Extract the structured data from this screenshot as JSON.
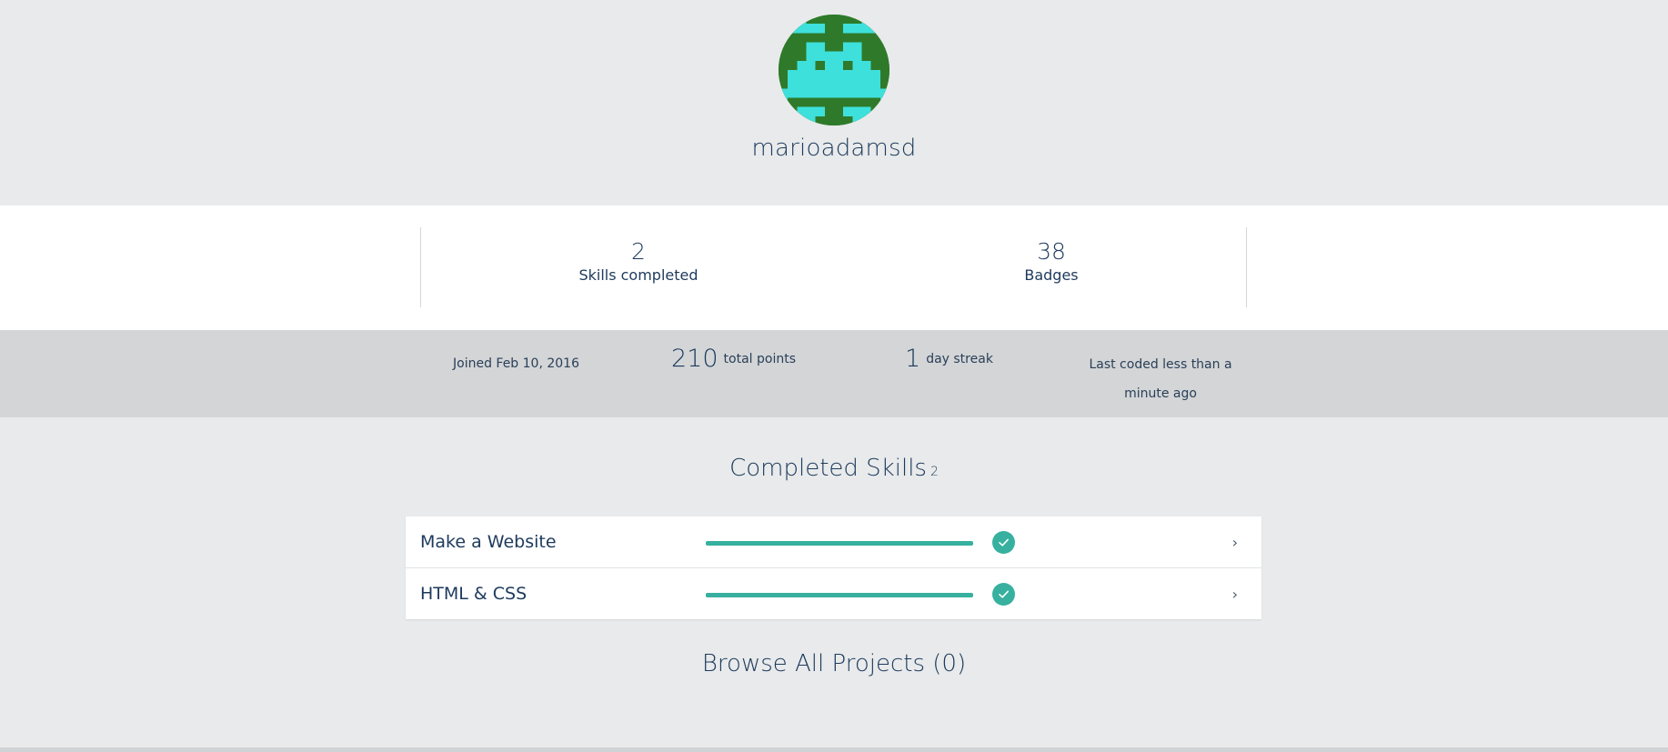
{
  "profile": {
    "username": "marioadamsd",
    "avatar_icon": "pixel-invader-avatar",
    "avatar_colors": {
      "background": "#2e7a2a",
      "foreground": "#3ee0dc"
    }
  },
  "stats": {
    "skills_completed": {
      "value": "2",
      "label": "Skills completed"
    },
    "badges": {
      "value": "38",
      "label": "Badges"
    }
  },
  "meta": {
    "joined": "Joined Feb 10, 2016",
    "points_value": "210",
    "points_label": "total points",
    "streak_value": "1",
    "streak_label": "day streak",
    "last_coded": "Last coded less than a minute ago"
  },
  "completed_skills": {
    "title": "Completed Skills",
    "count": "2",
    "items": [
      {
        "name": "Make a Website",
        "progress": 1.0,
        "status_icon": "check-icon",
        "chevron": "›"
      },
      {
        "name": "HTML & CSS",
        "progress": 1.0,
        "status_icon": "check-icon",
        "chevron": "›"
      }
    ]
  },
  "browse": {
    "label": "Browse All Projects (0)"
  },
  "colors": {
    "accent": "#37b09f",
    "text": "#1d3a5c",
    "page_bg": "#e8eaeb",
    "meta_bg": "#d3d5d7"
  }
}
